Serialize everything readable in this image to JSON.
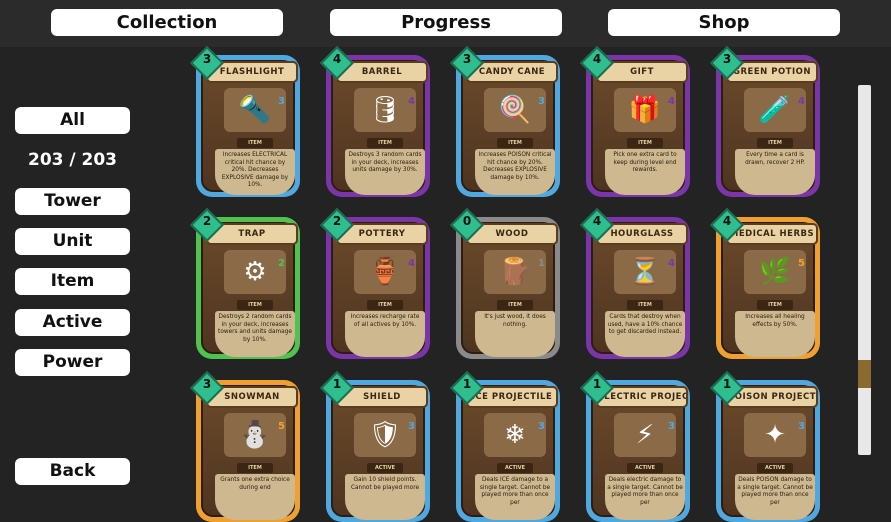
{
  "header": {
    "tabs": [
      {
        "label": "Collection"
      },
      {
        "label": "Progress"
      },
      {
        "label": "Shop"
      }
    ]
  },
  "sidebar": {
    "filters": [
      {
        "label": "All"
      },
      {
        "label": "Tower"
      },
      {
        "label": "Unit"
      },
      {
        "label": "Item"
      },
      {
        "label": "Active"
      },
      {
        "label": "Power"
      }
    ],
    "count": "203 / 203",
    "back_label": "Back"
  },
  "colors": {
    "rarity_blue": "#4fa8e0",
    "rarity_purple": "#7a36a8",
    "rarity_green": "#4fc24f",
    "rarity_gray": "#8a8a8a",
    "rarity_orange": "#f0a030"
  },
  "cards": [
    {
      "name": "FLASHLIGHT",
      "cost": "3",
      "stat": "3",
      "type": "ITEM",
      "desc": "Increases ELECTRICAL critical hit chance by 20%. Decreases EXPLOSIVE damage by 10%.",
      "rarity": "blue",
      "icon": "flashlight-icon",
      "glyph": "🔦"
    },
    {
      "name": "BARREL",
      "cost": "4",
      "stat": "4",
      "type": "ITEM",
      "desc": "Destroys 3 random cards in your deck, increases units damage by 30%.",
      "rarity": "purple",
      "icon": "barrel-icon",
      "glyph": "🛢"
    },
    {
      "name": "CANDY CANE",
      "cost": "3",
      "stat": "3",
      "type": "ITEM",
      "desc": "Increases POISON critical hit chance by 20%. Decreases EXPLOSIVE damage by 10%.",
      "rarity": "blue",
      "icon": "candy-cane-icon",
      "glyph": "🍭"
    },
    {
      "name": "GIFT",
      "cost": "4",
      "stat": "4",
      "type": "ITEM",
      "desc": "Pick one extra card to keep during level end rewards.",
      "rarity": "purple",
      "icon": "gift-icon",
      "glyph": "🎁"
    },
    {
      "name": "GREEN POTION",
      "cost": "3",
      "stat": "4",
      "type": "ITEM",
      "desc": "Every time a card is drawn, recover 2 HP.",
      "rarity": "purple",
      "icon": "potion-icon",
      "glyph": "🧪"
    },
    {
      "name": "TRAP",
      "cost": "2",
      "stat": "2",
      "type": "ITEM",
      "desc": "Destroys 2 random cards in your deck, increases towers and units damage by 10%.",
      "rarity": "green",
      "icon": "trap-icon",
      "glyph": "⚙"
    },
    {
      "name": "POTTERY",
      "cost": "2",
      "stat": "4",
      "type": "ITEM",
      "desc": "Increases recharge rate of all actives by 10%.",
      "rarity": "purple",
      "icon": "vase-icon",
      "glyph": "🏺"
    },
    {
      "name": "WOOD",
      "cost": "0",
      "stat": "1",
      "type": "ITEM",
      "desc": "It's just wood, it does nothing.",
      "rarity": "gray",
      "icon": "log-icon",
      "glyph": "🪵"
    },
    {
      "name": "HOURGLASS",
      "cost": "4",
      "stat": "4",
      "type": "ITEM",
      "desc": "Cards that destroy when used, have a 10% chance to get discarded instead.",
      "rarity": "purple",
      "icon": "hourglass-icon",
      "glyph": "⏳"
    },
    {
      "name": "MEDICAL HERBS",
      "cost": "4",
      "stat": "5",
      "type": "ITEM",
      "desc": "Increases all healing effects by 50%.",
      "rarity": "orange",
      "icon": "herbs-icon",
      "glyph": "🌿"
    },
    {
      "name": "SNOWMAN",
      "cost": "3",
      "stat": "5",
      "type": "ITEM",
      "desc": "Grants one extra choice during end",
      "rarity": "orange",
      "icon": "snowman-icon",
      "glyph": "⛄"
    },
    {
      "name": "SHIELD",
      "cost": "1",
      "stat": "3",
      "type": "ACTIVE",
      "desc": "Gain 10 shield points. Cannot be played more",
      "rarity": "blue",
      "icon": "shield-icon",
      "glyph": "🛡"
    },
    {
      "name": "ICE PROJECTILE",
      "cost": "1",
      "stat": "3",
      "type": "ACTIVE",
      "desc": "Deals ICE damage to a single target. Cannot be played more than once per",
      "rarity": "blue",
      "icon": "ice-shard-icon",
      "glyph": "❄"
    },
    {
      "name": "ELECTRIC PROJECTILE",
      "cost": "1",
      "stat": "3",
      "type": "ACTIVE",
      "desc": "Deals electric damage to a single target. Cannot be played more than once per",
      "rarity": "blue",
      "icon": "lightning-icon",
      "glyph": "⚡"
    },
    {
      "name": "POISON PROJECTILE",
      "cost": "1",
      "stat": "3",
      "type": "ACTIVE",
      "desc": "Deals POISON damage to a single target. Cannot be played more than once per",
      "rarity": "blue",
      "icon": "poison-shard-icon",
      "glyph": "✦"
    }
  ]
}
